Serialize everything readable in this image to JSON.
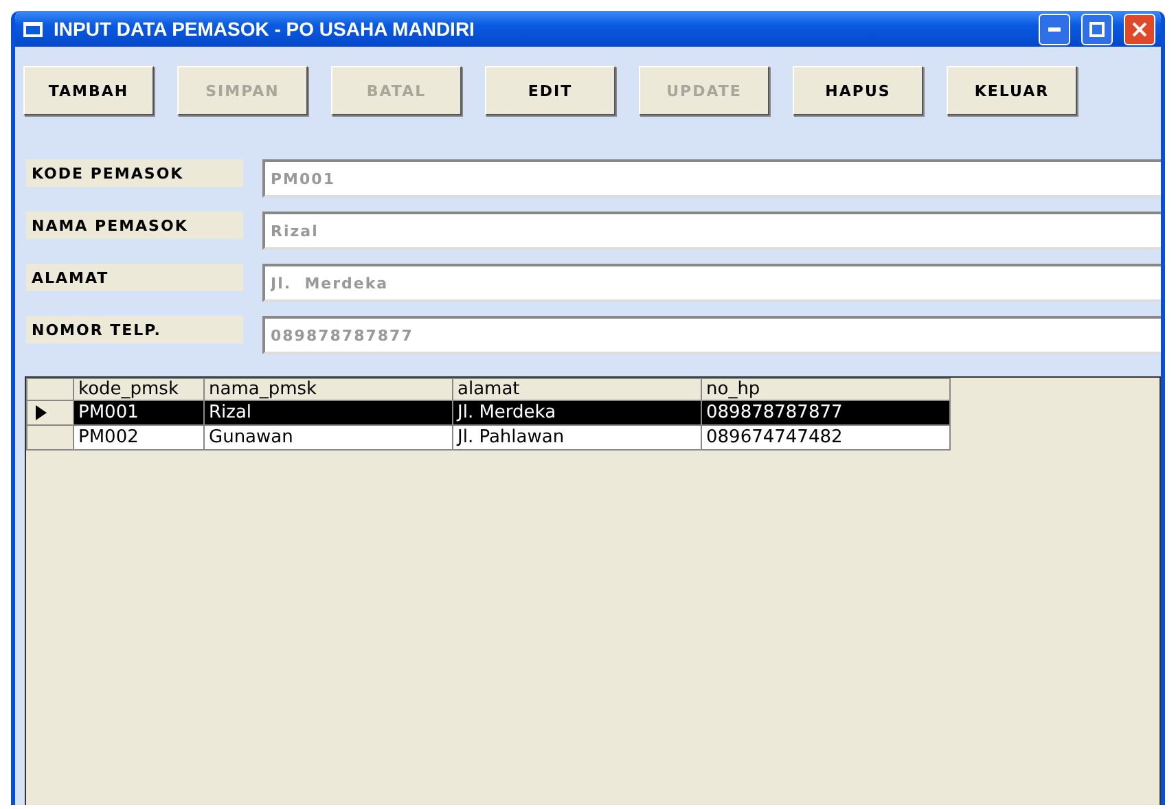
{
  "window": {
    "title": "INPUT DATA PEMASOK - PO USAHA MANDIRI"
  },
  "buttons": [
    {
      "label": "TAMBAH",
      "disabled": false
    },
    {
      "label": "SIMPAN",
      "disabled": true
    },
    {
      "label": "BATAL",
      "disabled": true
    },
    {
      "label": "EDIT",
      "disabled": false
    },
    {
      "label": "UPDATE",
      "disabled": true
    },
    {
      "label": "HAPUS",
      "disabled": false
    },
    {
      "label": "KELUAR",
      "disabled": false
    }
  ],
  "fields": [
    {
      "label": "KODE PEMASOK",
      "value": "PM001"
    },
    {
      "label": "NAMA PEMASOK",
      "value": "Rizal"
    },
    {
      "label": "ALAMAT",
      "value": "Jl.  Merdeka"
    },
    {
      "label": "NOMOR TELP.",
      "value": "089878787877"
    }
  ],
  "table": {
    "columns": [
      "kode_pmsk",
      "nama_pmsk",
      "alamat",
      "no_hp"
    ],
    "rows": [
      {
        "selected": true,
        "cells": [
          "PM001",
          "Rizal",
          "Jl. Merdeka",
          "089878787877"
        ]
      },
      {
        "selected": false,
        "cells": [
          "PM002",
          "Gunawan",
          "Jl. Pahlawan",
          "089674747482"
        ]
      }
    ]
  }
}
